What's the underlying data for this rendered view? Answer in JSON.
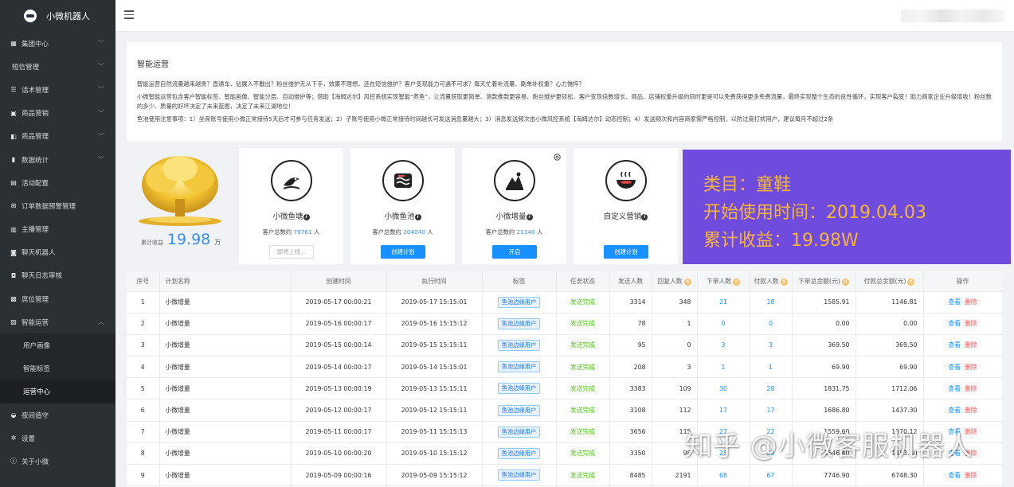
{
  "app": {
    "name": "小微机器人"
  },
  "sidebar": {
    "items": [
      {
        "label": "集团中心",
        "icon": "grid-icon",
        "chevron": true
      },
      {
        "label": "短信管理",
        "icon": "",
        "chevron": true
      },
      {
        "label": "话术管理",
        "icon": "list-icon",
        "chevron": true
      },
      {
        "label": "商品营销",
        "icon": "shop-icon",
        "chevron": true
      },
      {
        "label": "商品管理",
        "icon": "box-icon",
        "chevron": true
      },
      {
        "label": "数据统计",
        "icon": "chart-icon",
        "chevron": true
      },
      {
        "label": "活动配置",
        "icon": "calendar-icon",
        "chevron": false
      },
      {
        "label": "订单数据预警管理",
        "icon": "cart-icon",
        "chevron": false
      },
      {
        "label": "主播管理",
        "icon": "mic-icon",
        "chevron": false
      },
      {
        "label": "聊天机器人",
        "icon": "chat-icon",
        "chevron": false
      },
      {
        "label": "聊天日志审核",
        "icon": "chat-log-icon",
        "chevron": false
      },
      {
        "label": "席位管理",
        "icon": "seat-icon",
        "chevron": false
      },
      {
        "label": "智能运营",
        "icon": "image-icon",
        "chevron": true,
        "expanded": true
      },
      {
        "label": "用户画像",
        "sub": true
      },
      {
        "label": "智能标签",
        "sub": true
      },
      {
        "label": "运营中心",
        "sub": true,
        "active": true
      },
      {
        "label": "夜间值守",
        "icon": "moon-icon",
        "chevron": false
      },
      {
        "label": "设置",
        "icon": "gear-icon",
        "chevron": false
      },
      {
        "label": "关于小微",
        "icon": "info-icon",
        "chevron": false
      }
    ]
  },
  "intro": {
    "title": "智能运营",
    "p1": "智能运营自然流量越来越贵？直通车、钻展入不敷出？粉丝维护无从下手，效果不理想，还在短信维护？客户变现能力可遇不可求？每天忙着补流量、刷单补权重？心力憔悴？",
    "p2": "小微智能运营包含客户智能标签、智能画像、智能分层、自动维护等；借助【海姆达尔】风控系统实现智能“养鱼”，让流量获取更简单、测款推款更容易、粉丝维护更轻松、客户变现倍数增长、商品、店铺权重升级的同时更是可以免费获得更多免费流量，最终实现整个生态的良性循环，实现客户裂变！助力商家企业升级增收！粉丝数的多少、质量的好坏决定了未来蓝图，决定了未来江湖地位！",
    "p3": "鱼池使用注意事项：1）坐席账号使用小微正常接待5天后才可参与任务发送；2）子账号使用小微正常接待时间越长可发送消息量越大；3）消息发送频次由小微风控系统【海姆达尔】动态控制；4）发送频次和内容商家需严格控制，以防过度打扰用户，建议每月不超过2条"
  },
  "earnings": {
    "label": "累计收益",
    "value": "19.98",
    "unit": "万"
  },
  "cards": [
    {
      "title": "小微鱼塘",
      "count_label": "客户总数约",
      "count": "79761",
      "count_unit": "人",
      "button": "即将上线...",
      "disabled": true
    },
    {
      "title": "小微鱼池",
      "count_label": "客户总数约",
      "count": "204040",
      "count_unit": "人",
      "button": "创建计划",
      "disabled": false
    },
    {
      "title": "小微增量",
      "count_label": "客户总数约",
      "count": "21340",
      "count_unit": "人",
      "button": "开启",
      "disabled": false
    },
    {
      "title": "自定义营销",
      "count_label": "",
      "count": "",
      "count_unit": "",
      "button": "创建计划",
      "disabled": false
    }
  ],
  "promo": {
    "line1": "类目：童鞋",
    "line2": "开始使用时间：2019.04.03",
    "line3": "累计收益：19.98W"
  },
  "table": {
    "headers": [
      "序号",
      "计划名称",
      "创建时间",
      "执行时间",
      "标签",
      "任务状态",
      "发送人数",
      "回复人数",
      "下单人数",
      "付款人数",
      "下单总金额(元)",
      "付款总金额(元)",
      "操作"
    ],
    "action_view": "查看",
    "action_delete": "删除",
    "rows": [
      {
        "no": "1",
        "name": "小微增量",
        "created": "2019-05-17 00:00:21",
        "exec": "2019-05-17 15:15:01",
        "tag": "鱼池边缘用户",
        "status": "发送完成",
        "sent": "3314",
        "reply": "348",
        "order": "21",
        "paid": "18",
        "order_amt": "1585.91",
        "paid_amt": "1146.81"
      },
      {
        "no": "2",
        "name": "小微增量",
        "created": "2019-05-16 00:00:17",
        "exec": "2019-05-16 15:15:12",
        "tag": "鱼池边缘用户",
        "status": "发送完成",
        "sent": "78",
        "reply": "1",
        "order": "0",
        "paid": "0",
        "order_amt": "0.00",
        "paid_amt": "0.00"
      },
      {
        "no": "3",
        "name": "小微增量",
        "created": "2019-05-15 00:00:14",
        "exec": "2019-05-15 15:15:11",
        "tag": "鱼池边缘用户",
        "status": "发送完成",
        "sent": "95",
        "reply": "0",
        "order": "3",
        "paid": "3",
        "order_amt": "369.50",
        "paid_amt": "369.50"
      },
      {
        "no": "4",
        "name": "小微增量",
        "created": "2019-05-14 00:00:17",
        "exec": "2019-05-14 15:15:01",
        "tag": "鱼池边缘用户",
        "status": "发送完成",
        "sent": "208",
        "reply": "3",
        "order": "1",
        "paid": "1",
        "order_amt": "69.90",
        "paid_amt": "69.90"
      },
      {
        "no": "5",
        "name": "小微增量",
        "created": "2019-05-13 00:00:19",
        "exec": "2019-05-13 15:15:11",
        "tag": "鱼池边缘用户",
        "status": "发送完成",
        "sent": "3383",
        "reply": "109",
        "order": "30",
        "paid": "28",
        "order_amt": "1831.75",
        "paid_amt": "1712.06"
      },
      {
        "no": "6",
        "name": "小微增量",
        "created": "2019-05-12 00:00:17",
        "exec": "2019-05-12 15:15:11",
        "tag": "鱼池边缘用户",
        "status": "发送完成",
        "sent": "3108",
        "reply": "112",
        "order": "17",
        "paid": "17",
        "order_amt": "1686.80",
        "paid_amt": "1437.30"
      },
      {
        "no": "7",
        "name": "小微增量",
        "created": "2019-05-11 00:00:17",
        "exec": "2019-05-11 15:15:13",
        "tag": "鱼池边缘用户",
        "status": "发送完成",
        "sent": "3656",
        "reply": "115",
        "order": "27",
        "paid": "22",
        "order_amt": "1559.60",
        "paid_amt": "1370.12"
      },
      {
        "no": "8",
        "name": "小微增量",
        "created": "2019-05-10 00:00:20",
        "exec": "2019-05-10 15:15:12",
        "tag": "鱼池边缘用户",
        "status": "发送完成",
        "sent": "3350",
        "reply": "98",
        "order": "25",
        "paid": "23",
        "order_amt": "1646.40",
        "paid_amt": "1453.10"
      },
      {
        "no": "9",
        "name": "小微增量",
        "created": "2019-05-09 00:00:16",
        "exec": "2019-05-09 15:15:12",
        "tag": "鱼池边缘用户",
        "status": "发送完成",
        "sent": "8485",
        "reply": "2191",
        "order": "68",
        "paid": "67",
        "order_amt": "7746.90",
        "paid_amt": "6748.30"
      }
    ]
  },
  "watermark": "知乎 @小微客服机器人",
  "colors": {
    "accent": "#1890ff",
    "promo_bg": "#6f4bde",
    "promo_text": "#f7b43a",
    "success": "#52c41a",
    "danger": "#ff4d4f",
    "sidebar_bg": "#2b3035"
  }
}
